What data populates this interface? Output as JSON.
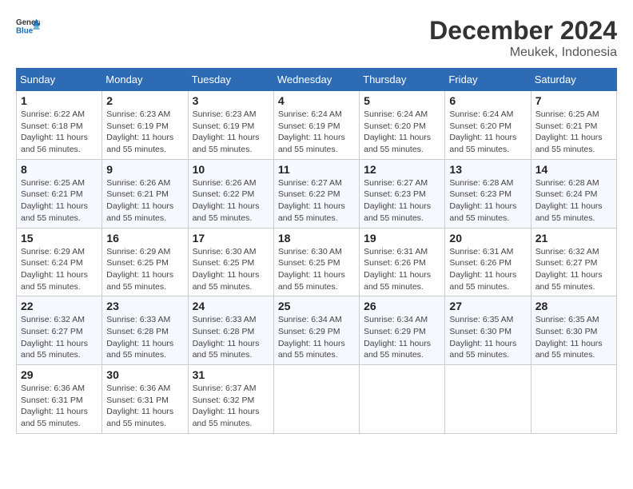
{
  "header": {
    "logo_line1": "General",
    "logo_line2": "Blue",
    "month_year": "December 2024",
    "location": "Meukek, Indonesia"
  },
  "weekdays": [
    "Sunday",
    "Monday",
    "Tuesday",
    "Wednesday",
    "Thursday",
    "Friday",
    "Saturday"
  ],
  "weeks": [
    [
      {
        "day": "1",
        "sunrise": "6:22 AM",
        "sunset": "6:18 PM",
        "daylight": "11 hours and 56 minutes."
      },
      {
        "day": "2",
        "sunrise": "6:23 AM",
        "sunset": "6:19 PM",
        "daylight": "11 hours and 55 minutes."
      },
      {
        "day": "3",
        "sunrise": "6:23 AM",
        "sunset": "6:19 PM",
        "daylight": "11 hours and 55 minutes."
      },
      {
        "day": "4",
        "sunrise": "6:24 AM",
        "sunset": "6:19 PM",
        "daylight": "11 hours and 55 minutes."
      },
      {
        "day": "5",
        "sunrise": "6:24 AM",
        "sunset": "6:20 PM",
        "daylight": "11 hours and 55 minutes."
      },
      {
        "day": "6",
        "sunrise": "6:24 AM",
        "sunset": "6:20 PM",
        "daylight": "11 hours and 55 minutes."
      },
      {
        "day": "7",
        "sunrise": "6:25 AM",
        "sunset": "6:21 PM",
        "daylight": "11 hours and 55 minutes."
      }
    ],
    [
      {
        "day": "8",
        "sunrise": "6:25 AM",
        "sunset": "6:21 PM",
        "daylight": "11 hours and 55 minutes."
      },
      {
        "day": "9",
        "sunrise": "6:26 AM",
        "sunset": "6:21 PM",
        "daylight": "11 hours and 55 minutes."
      },
      {
        "day": "10",
        "sunrise": "6:26 AM",
        "sunset": "6:22 PM",
        "daylight": "11 hours and 55 minutes."
      },
      {
        "day": "11",
        "sunrise": "6:27 AM",
        "sunset": "6:22 PM",
        "daylight": "11 hours and 55 minutes."
      },
      {
        "day": "12",
        "sunrise": "6:27 AM",
        "sunset": "6:23 PM",
        "daylight": "11 hours and 55 minutes."
      },
      {
        "day": "13",
        "sunrise": "6:28 AM",
        "sunset": "6:23 PM",
        "daylight": "11 hours and 55 minutes."
      },
      {
        "day": "14",
        "sunrise": "6:28 AM",
        "sunset": "6:24 PM",
        "daylight": "11 hours and 55 minutes."
      }
    ],
    [
      {
        "day": "15",
        "sunrise": "6:29 AM",
        "sunset": "6:24 PM",
        "daylight": "11 hours and 55 minutes."
      },
      {
        "day": "16",
        "sunrise": "6:29 AM",
        "sunset": "6:25 PM",
        "daylight": "11 hours and 55 minutes."
      },
      {
        "day": "17",
        "sunrise": "6:30 AM",
        "sunset": "6:25 PM",
        "daylight": "11 hours and 55 minutes."
      },
      {
        "day": "18",
        "sunrise": "6:30 AM",
        "sunset": "6:25 PM",
        "daylight": "11 hours and 55 minutes."
      },
      {
        "day": "19",
        "sunrise": "6:31 AM",
        "sunset": "6:26 PM",
        "daylight": "11 hours and 55 minutes."
      },
      {
        "day": "20",
        "sunrise": "6:31 AM",
        "sunset": "6:26 PM",
        "daylight": "11 hours and 55 minutes."
      },
      {
        "day": "21",
        "sunrise": "6:32 AM",
        "sunset": "6:27 PM",
        "daylight": "11 hours and 55 minutes."
      }
    ],
    [
      {
        "day": "22",
        "sunrise": "6:32 AM",
        "sunset": "6:27 PM",
        "daylight": "11 hours and 55 minutes."
      },
      {
        "day": "23",
        "sunrise": "6:33 AM",
        "sunset": "6:28 PM",
        "daylight": "11 hours and 55 minutes."
      },
      {
        "day": "24",
        "sunrise": "6:33 AM",
        "sunset": "6:28 PM",
        "daylight": "11 hours and 55 minutes."
      },
      {
        "day": "25",
        "sunrise": "6:34 AM",
        "sunset": "6:29 PM",
        "daylight": "11 hours and 55 minutes."
      },
      {
        "day": "26",
        "sunrise": "6:34 AM",
        "sunset": "6:29 PM",
        "daylight": "11 hours and 55 minutes."
      },
      {
        "day": "27",
        "sunrise": "6:35 AM",
        "sunset": "6:30 PM",
        "daylight": "11 hours and 55 minutes."
      },
      {
        "day": "28",
        "sunrise": "6:35 AM",
        "sunset": "6:30 PM",
        "daylight": "11 hours and 55 minutes."
      }
    ],
    [
      {
        "day": "29",
        "sunrise": "6:36 AM",
        "sunset": "6:31 PM",
        "daylight": "11 hours and 55 minutes."
      },
      {
        "day": "30",
        "sunrise": "6:36 AM",
        "sunset": "6:31 PM",
        "daylight": "11 hours and 55 minutes."
      },
      {
        "day": "31",
        "sunrise": "6:37 AM",
        "sunset": "6:32 PM",
        "daylight": "11 hours and 55 minutes."
      },
      null,
      null,
      null,
      null
    ]
  ]
}
